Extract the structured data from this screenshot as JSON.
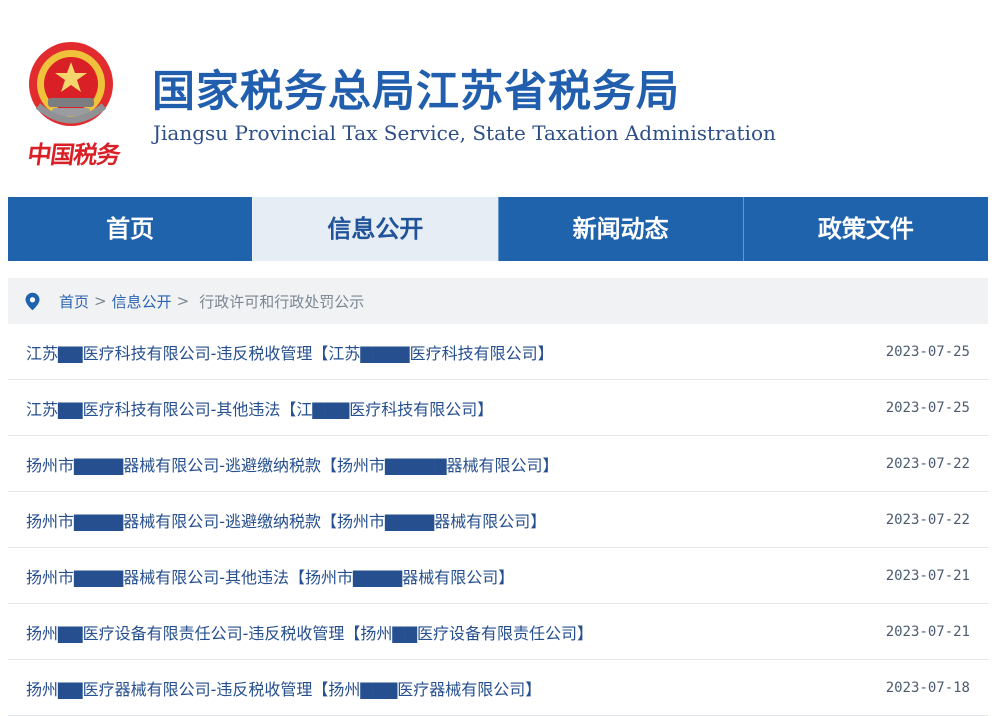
{
  "site": {
    "title_cn": "国家税务总局江苏省税务局",
    "title_en": "Jiangsu Provincial Tax Service, State Taxation Administration",
    "seal_text": "中国税务",
    "colors": {
      "primary": "#1f63ad",
      "active_bg": "#e7edf4",
      "seal_red": "#d92027"
    }
  },
  "nav": {
    "items": [
      {
        "label": "首页"
      },
      {
        "label": "信息公开"
      },
      {
        "label": "新闻动态"
      },
      {
        "label": "政策文件"
      }
    ]
  },
  "breadcrumb": {
    "home": "首页",
    "level2": "信息公开",
    "current": "行政许可和行政处罚公示",
    "separator": ">"
  },
  "list": {
    "items": [
      {
        "title": "江苏▇▇医疗科技有限公司-违反税收管理【江苏▇▇▇▇医疗科技有限公司】",
        "date": "2023-07-25"
      },
      {
        "title": "江苏▇▇医疗科技有限公司-其他违法【江▇▇▇医疗科技有限公司】",
        "date": "2023-07-25"
      },
      {
        "title": "扬州市▇▇▇▇器械有限公司-逃避缴纳税款【扬州市▇▇▇▇▇器械有限公司】",
        "date": "2023-07-22"
      },
      {
        "title": "扬州市▇▇▇▇器械有限公司-逃避缴纳税款【扬州市▇▇▇▇器械有限公司】",
        "date": "2023-07-22"
      },
      {
        "title": "扬州市▇▇▇▇器械有限公司-其他违法【扬州市▇▇▇▇器械有限公司】",
        "date": "2023-07-21"
      },
      {
        "title": "扬州▇▇医疗设备有限责任公司-违反税收管理【扬州▇▇医疗设备有限责任公司】",
        "date": "2023-07-21"
      },
      {
        "title": "扬州▇▇医疗器械有限公司-违反税收管理【扬州▇▇▇医疗器械有限公司】",
        "date": "2023-07-18"
      }
    ]
  }
}
